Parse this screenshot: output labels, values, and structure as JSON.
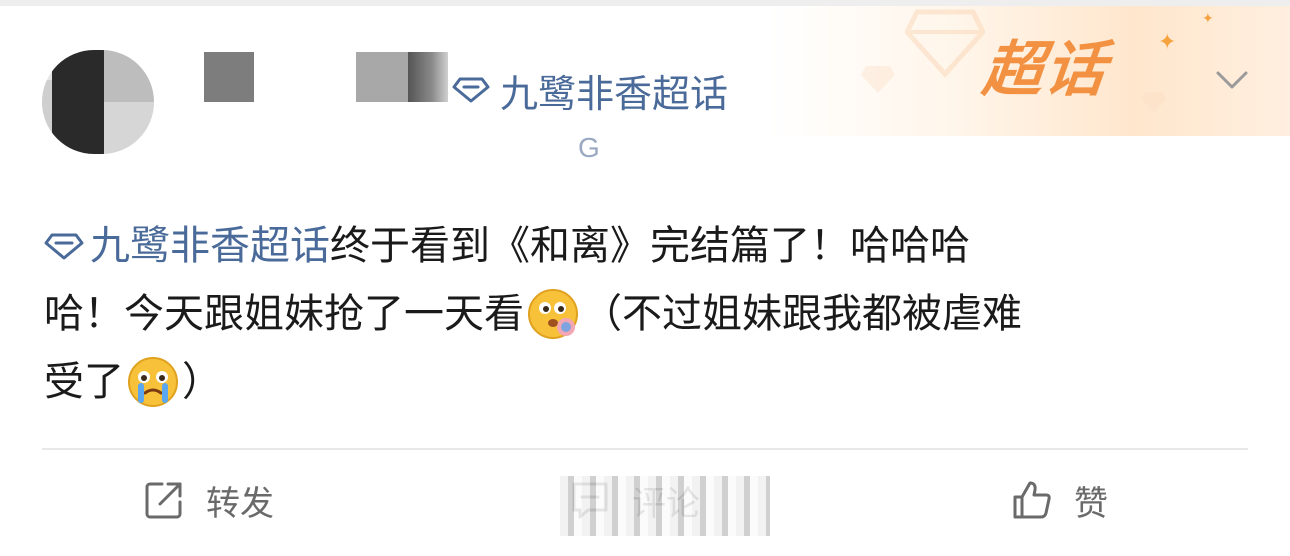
{
  "post": {
    "author": {
      "avatar_icon": "blurred-avatar",
      "name_hidden": true,
      "topic_prefix_icon": "diamond-icon",
      "topic_name": "九鹭非香超话",
      "sub_line": "G"
    },
    "supertopic_badge": {
      "label": "超话",
      "color": "#f39143",
      "more_icon": "chevron-down-icon"
    },
    "content": {
      "topic_link": "九鹭非香超话",
      "line1_text": "终于看到《和离》完结篇了！哈哈哈",
      "line2_text_a": "哈！今天跟姐妹抢了一天看",
      "emoji_1": "thinking-face-emoji",
      "line2_text_b": "（不过姐妹跟我都被虐难",
      "line3_text_a": "受了",
      "emoji_2": "crying-face-emoji",
      "line3_text_b": "）"
    },
    "actions": {
      "repost_icon": "share-icon",
      "repost_label": "转发",
      "comment_icon": "comment-icon",
      "comment_label": "评论",
      "like_icon": "thumbs-up-icon",
      "like_label": "赞"
    },
    "colors": {
      "topic_blue": "#4a6a9a",
      "text": "#1a1a1a",
      "action_gray": "#6a6a6a"
    }
  }
}
